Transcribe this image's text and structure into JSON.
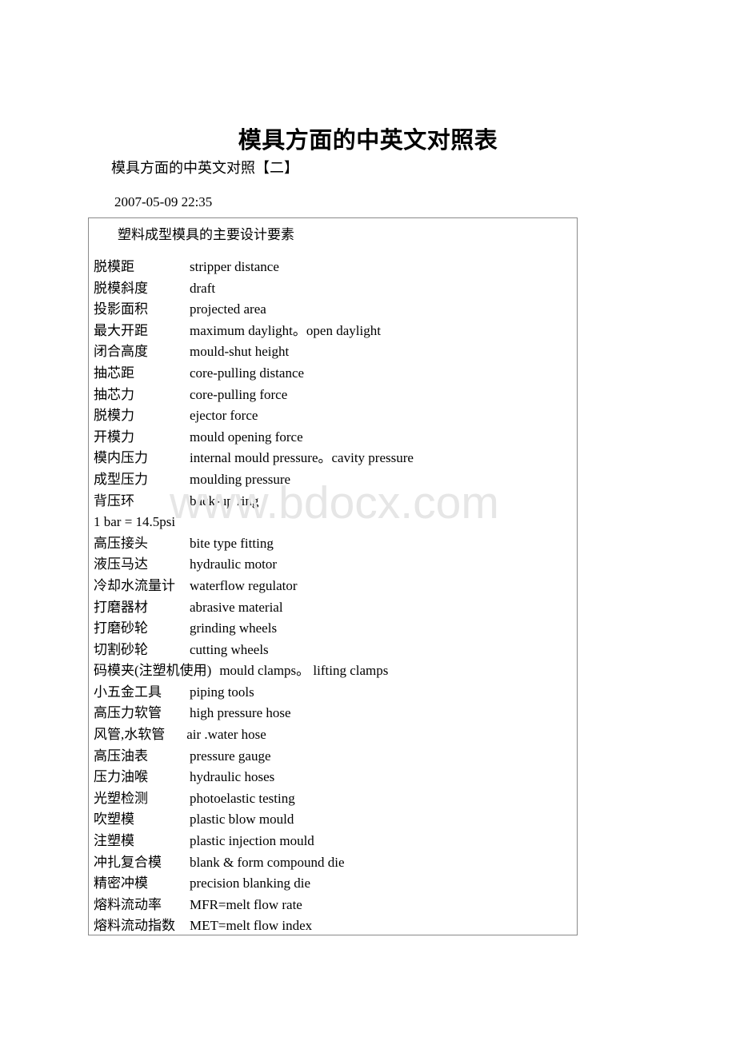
{
  "document": {
    "title": "模具方面的中英文对照表",
    "subtitle": "模具方面的中英文对照【二】",
    "timestamp": "2007-05-09 22:35",
    "watermark": "www.bdocx.com"
  },
  "glossary": {
    "heading": "塑料成型模具的主要设计要素",
    "rows": [
      {
        "cn": "脱模距",
        "en": "stripper distance"
      },
      {
        "cn": "脱模斜度",
        "en": "draft"
      },
      {
        "cn": "投影面积",
        "en": "projected area"
      },
      {
        "cn": "最大开距",
        "en": "maximum daylight。open daylight"
      },
      {
        "cn": "闭合高度",
        "en": "mould-shut height"
      },
      {
        "cn": "抽芯距",
        "en": "core-pulling distance"
      },
      {
        "cn": "抽芯力",
        "en": "core-pulling force"
      },
      {
        "cn": "脱模力",
        "en": "ejector force"
      },
      {
        "cn": "开模力",
        "en": "mould opening force"
      },
      {
        "cn": "模内压力",
        "en": "internal mould pressure。cavity pressure"
      },
      {
        "cn": "成型压力",
        "en": "moulding pressure"
      },
      {
        "cn": "背压环",
        "en": "back-up ring"
      },
      {
        "cn": "1 bar = 14.5psi",
        "en": ""
      },
      {
        "cn": "高压接头",
        "en": "bite type fitting"
      },
      {
        "cn": "液压马达",
        "en": "hydraulic motor"
      },
      {
        "cn": "冷却水流量计",
        "en": "waterflow regulator"
      },
      {
        "cn": "打磨器材",
        "en": "abrasive material"
      },
      {
        "cn": "打磨砂轮",
        "en": "grinding wheels"
      },
      {
        "cn": "切割砂轮",
        "en": "cutting wheels"
      },
      {
        "cn": "码模夹(注塑机使用)",
        "en": "mould clamps。 lifting clamps"
      },
      {
        "cn": "小五金工具",
        "en": "piping tools"
      },
      {
        "cn": "高压力软管",
        "en": "high pressure hose"
      },
      {
        "cn": "风管,水软管",
        "en": "air .water hose"
      },
      {
        "cn": "高压油表",
        "en": "pressure gauge"
      },
      {
        "cn": "压力油喉",
        "en": "hydraulic hoses"
      },
      {
        "cn": "光塑检测",
        "en": "photoelastic testing"
      },
      {
        "cn": "吹塑模",
        "en": "plastic blow mould"
      },
      {
        "cn": "注塑模",
        "en": "plastic injection mould"
      },
      {
        "cn": "冲扎复合模",
        "en": "blank & form compound die"
      },
      {
        "cn": "精密冲模",
        "en": "precision blanking die"
      },
      {
        "cn": "熔料流动率",
        "en": "MFR=melt flow rate"
      },
      {
        "cn": "熔料流动指数",
        "en": "MET=melt flow index"
      }
    ]
  },
  "colors": {
    "text": "#000000",
    "table_border": "#8a8a8a",
    "watermark": "#e6e6e6",
    "page_background": "#ffffff"
  }
}
